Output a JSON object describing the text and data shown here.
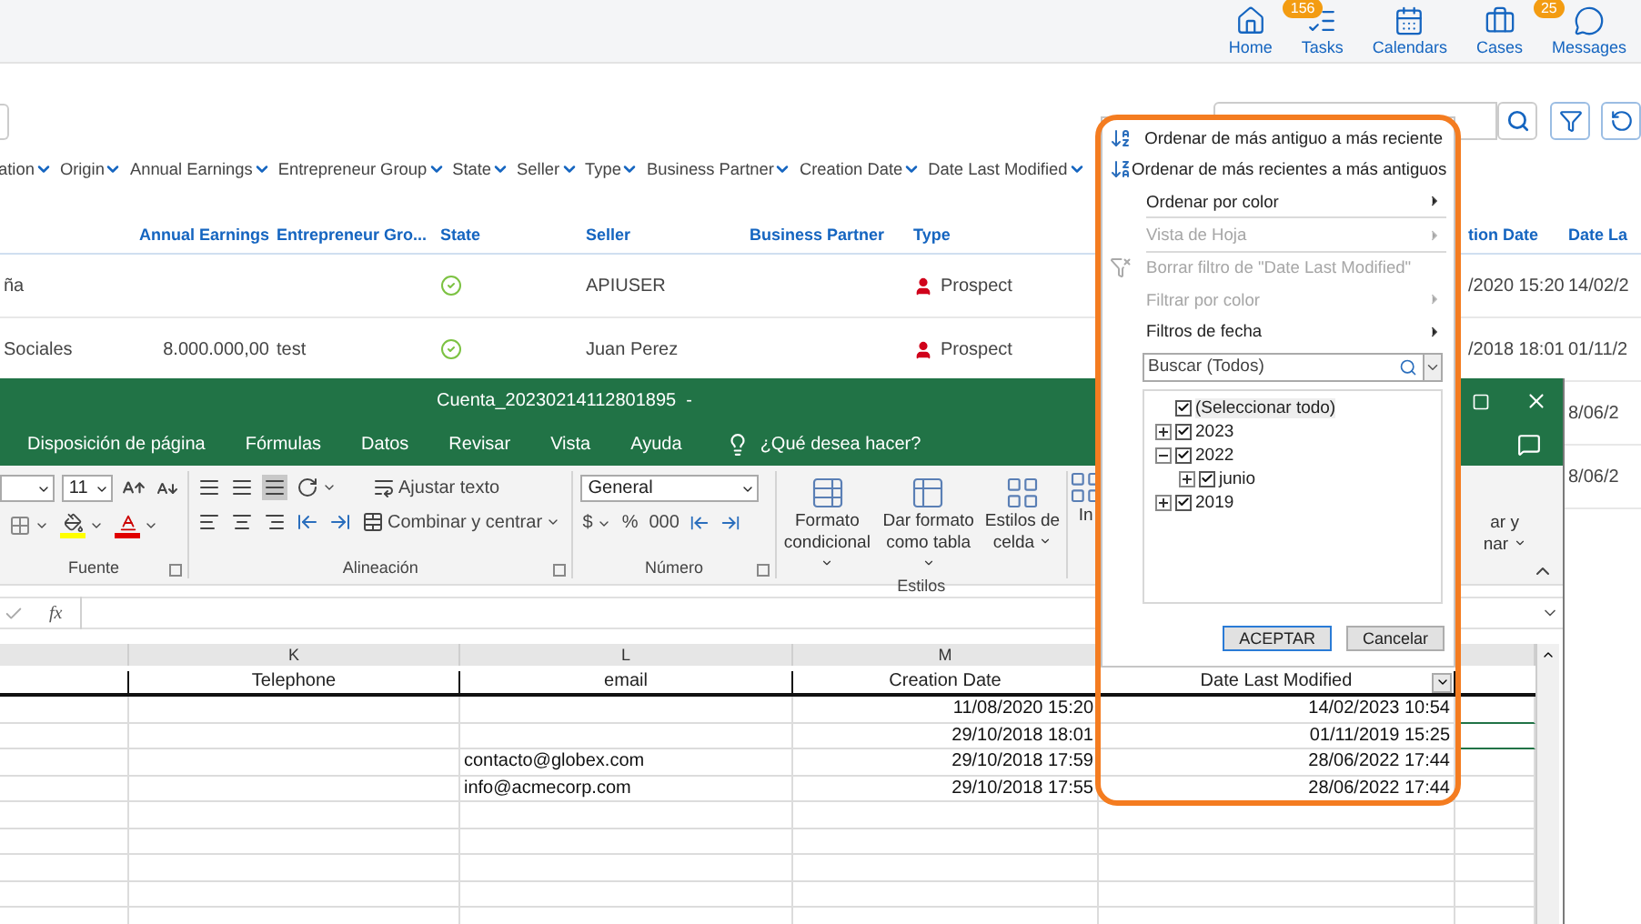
{
  "top_nav": [
    {
      "label": "Home"
    },
    {
      "label": "Tasks",
      "badge": "156"
    },
    {
      "label": "Calendars"
    },
    {
      "label": "Cases"
    },
    {
      "label": "Messages",
      "badge": "25"
    }
  ],
  "filters": [
    "ation",
    "Origin",
    "Annual Earnings",
    "Entrepreneur Group",
    "State",
    "Seller",
    "Type",
    "Business Partner",
    "Creation Date",
    "Date Last Modified"
  ],
  "table": {
    "headers": {
      "annual_earnings": "Annual Earnings",
      "entrepreneur_group": "Entrepreneur Gro...",
      "state": "State",
      "seller": "Seller",
      "business_partner": "Business Partner",
      "type": "Type",
      "creation_date": "tion Date",
      "date_last_modified": "Date La"
    },
    "rows": [
      {
        "column_1": "ña",
        "status_ok": true,
        "seller": "APIUSER",
        "type": "Prospect",
        "creation_date": "/2020 15:20",
        "date_last_modified": "14/02/2"
      },
      {
        "column_1": "Sociales",
        "annual_earnings": "8.000.000,00",
        "entrepreneur_group": "test",
        "status_ok": true,
        "seller": "Juan Perez",
        "type": "Prospect",
        "creation_date": "/2018 18:01",
        "date_last_modified": "01/11/2"
      },
      {
        "date_last_modified": "8/06/2"
      },
      {
        "date_last_modified": "8/06/2"
      }
    ]
  },
  "excel": {
    "title": "Cuenta_20230214112801895  -",
    "menu": [
      "Disposición de página",
      "Fórmulas",
      "Datos",
      "Revisar",
      "Vista",
      "Ayuda"
    ],
    "tell_me": "¿Qué desea hacer?",
    "ribbon": {
      "font_size": "11",
      "wrap_text": "Ajustar texto",
      "merge": "Combinar y centrar",
      "number_format": "General",
      "number_buttons": [
        "$",
        "%",
        "000"
      ],
      "styles": [
        "Formato condicional",
        "Dar formato como tabla",
        "Estilos de celda"
      ],
      "insert": "In",
      "sort_filter": [
        "ar y",
        "nar"
      ],
      "groups": [
        "Fuente",
        "Alineación",
        "Número",
        "Estilos"
      ]
    },
    "function_label": "fx",
    "sheet": {
      "columns": [
        {
          "letter": "K",
          "header": "Telephone"
        },
        {
          "letter": "L",
          "header": "email"
        },
        {
          "letter": "M",
          "header": "Creation Date"
        },
        {
          "header": "Date Last Modified",
          "filter": true
        }
      ],
      "rows": [
        {
          "creation_date": "11/08/2020 15:20",
          "date_last_modified": "14/02/2023 10:54"
        },
        {
          "creation_date": "29/10/2018 18:01",
          "date_last_modified": "01/11/2019 15:25"
        },
        {
          "email": "contacto@globex.com",
          "creation_date": "29/10/2018 17:59",
          "date_last_modified": "28/06/2022 17:44"
        },
        {
          "email": "info@acmecorp.com",
          "creation_date": "29/10/2018 17:55",
          "date_last_modified": "28/06/2022 17:44"
        }
      ]
    }
  },
  "filter_popup": {
    "menu": [
      {
        "label": "Ordenar de más antiguo a más reciente",
        "kind": "sort_asc",
        "disabled": false,
        "submenu": false,
        "separator_after": false
      },
      {
        "label": "Ordenar de más recientes a más antiguos",
        "kind": "sort_desc",
        "disabled": false,
        "submenu": false,
        "separator_after": false
      },
      {
        "label": "Ordenar por color",
        "kind": "plain",
        "disabled": false,
        "submenu": true,
        "separator_after": true
      },
      {
        "label": "Vista de Hoja",
        "kind": "plain",
        "disabled": true,
        "submenu": true,
        "separator_after": true
      },
      {
        "label": "Borrar filtro de \"Date Last Modified\"",
        "kind": "clear_filter",
        "disabled": true,
        "submenu": false,
        "separator_after": false
      },
      {
        "label": "Filtrar por color",
        "kind": "plain",
        "disabled": true,
        "submenu": true,
        "separator_after": false
      },
      {
        "label": "Filtros de fecha",
        "kind": "plain",
        "disabled": false,
        "submenu": true,
        "separator_after": false
      }
    ],
    "search": {
      "placeholder": "Buscar (Todos)"
    },
    "tree": [
      {
        "label": "(Seleccionar todo)",
        "checked": true
      },
      {
        "label": "2023",
        "checked": true,
        "expanded": false
      },
      {
        "label": "2022",
        "checked": true,
        "expanded": true,
        "children": [
          {
            "label": "junio",
            "checked": true,
            "expanded": false
          }
        ]
      },
      {
        "label": "2019",
        "checked": true,
        "expanded": false
      }
    ],
    "buttons": [
      {
        "label": "ACEPTAR",
        "default": true
      },
      {
        "label": "Cancelar",
        "default": false
      }
    ]
  }
}
